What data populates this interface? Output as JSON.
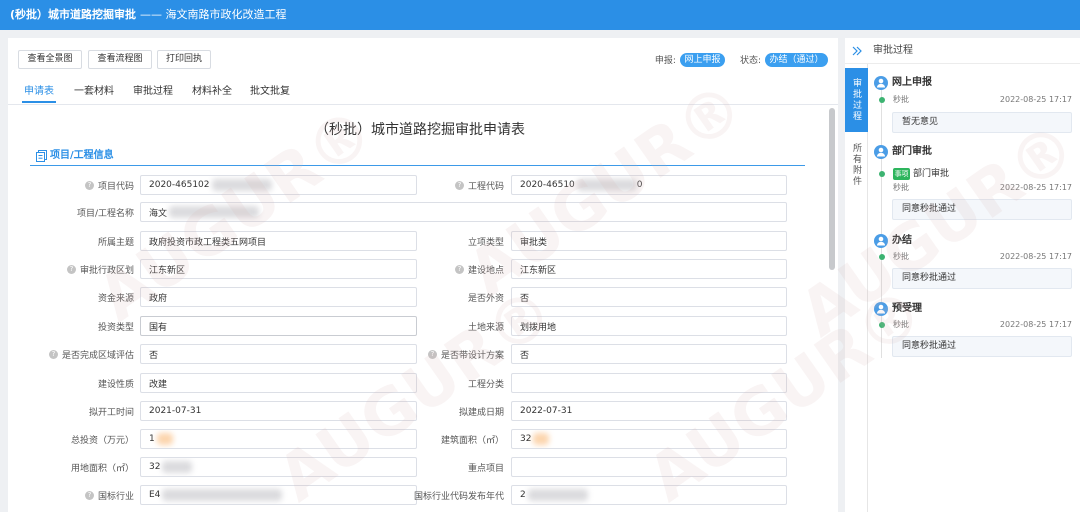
{
  "header": {
    "title_main": "(秒批）城市道路挖掘审批",
    "title_sub": "—— 海文南路市政化改造工程"
  },
  "toolbar": {
    "buttons": [
      "查看全景图",
      "查看流程图",
      "打印回执"
    ],
    "declare_label": "申报:",
    "declare_value": "网上申报",
    "status_label": "状态:",
    "status_value": "办结（通过）"
  },
  "tabs": {
    "items": [
      "申请表",
      "一套材料",
      "审批过程",
      "材料补全",
      "批文批复"
    ],
    "active_index": 0
  },
  "form": {
    "title": "（秒批）城市道路挖掘审批申请表",
    "section_title": "项目/工程信息",
    "rows": [
      {
        "left": {
          "label": "项目代码",
          "help": true,
          "value": "2020-465102"
        },
        "right": {
          "label": "工程代码",
          "help": true,
          "value": "2020-46510",
          "value_tail": "0"
        }
      },
      {
        "full": {
          "label": "项目/工程名称",
          "value": "海文"
        }
      },
      {
        "left": {
          "label": "所属主题",
          "value": "政府投资市政工程类五网项目"
        },
        "right": {
          "label": "立项类型",
          "value": "审批类"
        }
      },
      {
        "left": {
          "label": "审批行政区划",
          "help": true,
          "value": "江东新区"
        },
        "right": {
          "label": "建设地点",
          "help": true,
          "value": "江东新区"
        }
      },
      {
        "left": {
          "label": "资金来源",
          "value": "政府"
        },
        "right": {
          "label": "是否外资",
          "value": "否"
        }
      },
      {
        "left": {
          "label": "投资类型",
          "value": "国有"
        },
        "right": {
          "label": "土地来源",
          "value": "划拨用地"
        }
      },
      {
        "left": {
          "label": "是否完成区域评估",
          "help": true,
          "value": "否"
        },
        "right": {
          "label": "是否带设计方案",
          "help": true,
          "value": "否"
        }
      },
      {
        "left": {
          "label": "建设性质",
          "value": "改建"
        },
        "right": {
          "label": "工程分类",
          "value": ""
        }
      },
      {
        "left": {
          "label": "拟开工时间",
          "value": "2021-07-31"
        },
        "right": {
          "label": "拟建成日期",
          "value": "2022-07-31"
        }
      },
      {
        "left": {
          "label": "总投资（万元）",
          "value": "1"
        },
        "right": {
          "label": "建筑面积（㎡）",
          "value": "32"
        }
      },
      {
        "left": {
          "label": "用地面积（㎡）",
          "value": "32"
        },
        "right": {
          "label": "重点项目",
          "value": ""
        }
      },
      {
        "left": {
          "label": "国标行业",
          "help": true,
          "value": "E4"
        },
        "right": {
          "label": "国标行业代码发布年代",
          "value": "2"
        }
      }
    ]
  },
  "side": {
    "title": "审批过程",
    "vtabs": [
      "审批过程",
      "所有附件"
    ],
    "timeline": [
      {
        "title": "网上申报",
        "handler": "秒批",
        "time": "2022-08-25 17:17",
        "opinion": "暂无意见"
      },
      {
        "title": "部门审批",
        "badge": "事项",
        "badge_label": "部门审批",
        "handler": "秒批",
        "time": "2022-08-25 17:17",
        "opinion": "同意秒批通过"
      },
      {
        "title": "办结",
        "handler": "秒批",
        "time": "2022-08-25 17:17",
        "opinion": "同意秒批通过"
      },
      {
        "title": "预受理",
        "handler": "秒批",
        "time": "2022-08-25 17:17",
        "opinion": "同意秒批通过"
      }
    ]
  },
  "watermark": "AUGUR®",
  "colors": {
    "primary": "#2b8fe6",
    "badge_green": "#2db55d",
    "timeline_dot": "#3cb371"
  }
}
